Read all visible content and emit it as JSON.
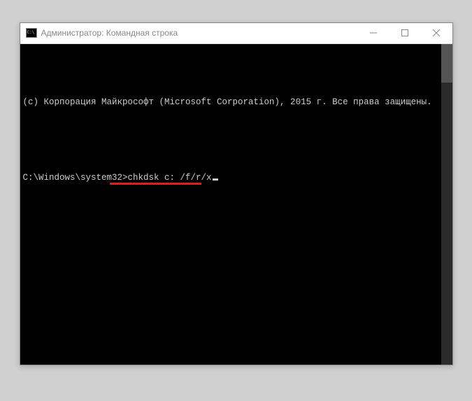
{
  "titlebar": {
    "title": "Администратор: Командная строка"
  },
  "console": {
    "copyright": "(с) Корпорация Майкрософт (Microsoft Corporation), 2015 г. Все права защищены.",
    "blank": " ",
    "prompt": "C:\\Windows\\system32>",
    "command": "chkdsk c: /f/r/x"
  }
}
